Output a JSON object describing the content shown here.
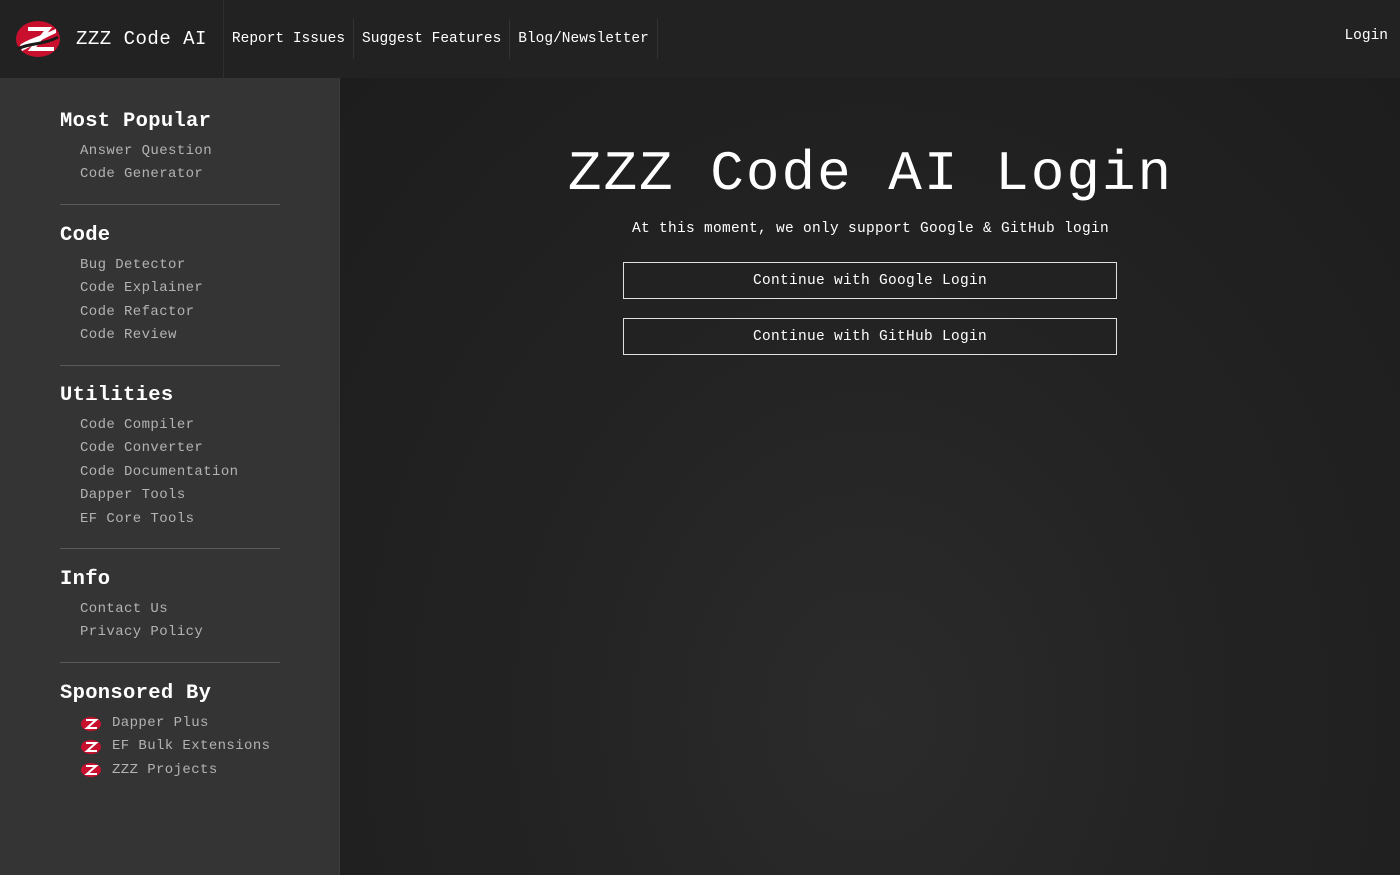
{
  "header": {
    "brand_name": "ZZZ Code AI",
    "logo_icon": "zzz-logo-icon",
    "nav": [
      {
        "label": "Report Issues"
      },
      {
        "label": "Suggest Features"
      },
      {
        "label": "Blog/Newsletter"
      }
    ],
    "login_label": "Login"
  },
  "sidebar": {
    "sections": [
      {
        "title": "Most Popular",
        "items": [
          "Answer Question",
          "Code Generator"
        ]
      },
      {
        "title": "Code",
        "items": [
          "Bug Detector",
          "Code Explainer",
          "Code Refactor",
          "Code Review"
        ]
      },
      {
        "title": "Utilities",
        "items": [
          "Code Compiler",
          "Code Converter",
          "Code Documentation",
          "Dapper Tools",
          "EF Core Tools"
        ]
      },
      {
        "title": "Info",
        "items": [
          "Contact Us",
          "Privacy Policy"
        ]
      },
      {
        "title": "Sponsored By",
        "items": [
          "Dapper Plus",
          "EF Bulk Extensions",
          "ZZZ Projects"
        ]
      }
    ]
  },
  "main": {
    "title": "ZZZ Code AI Login",
    "subtitle": "At this moment, we only support Google & GitHub login",
    "google_button": "Continue with Google Login",
    "github_button": "Continue with GitHub Login"
  },
  "colors": {
    "topbar_bg": "#222222",
    "sidebar_bg": "#343434",
    "main_bg": "#1e1e1e",
    "logo_red": "#c8102e"
  }
}
